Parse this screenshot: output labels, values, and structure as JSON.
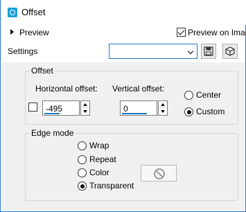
{
  "window": {
    "title": "Offset"
  },
  "preview": {
    "label": "Preview",
    "preview_on_image": "Preview on Imag",
    "preview_on_image_checked": true
  },
  "settings": {
    "label": "Settings",
    "combo_value": "",
    "save_icon": "floppy-disk-icon",
    "presets_icon": "cube-icon"
  },
  "offset_group": {
    "title": "Offset",
    "link_checked": false,
    "horizontal": {
      "label": "Horizontal offset:",
      "value": "-495"
    },
    "vertical": {
      "label": "Vertical offset:",
      "value": "0"
    },
    "options": [
      {
        "label": "Center",
        "checked": false
      },
      {
        "label": "Custom",
        "checked": true
      }
    ]
  },
  "edge_group": {
    "title": "Edge mode",
    "options": [
      {
        "label": "Wrap",
        "checked": false
      },
      {
        "label": "Repeat",
        "checked": false
      },
      {
        "label": "Color",
        "checked": false
      },
      {
        "label": "Transparent",
        "checked": true
      }
    ],
    "color_swatch_icon": "no-symbol-icon"
  }
}
